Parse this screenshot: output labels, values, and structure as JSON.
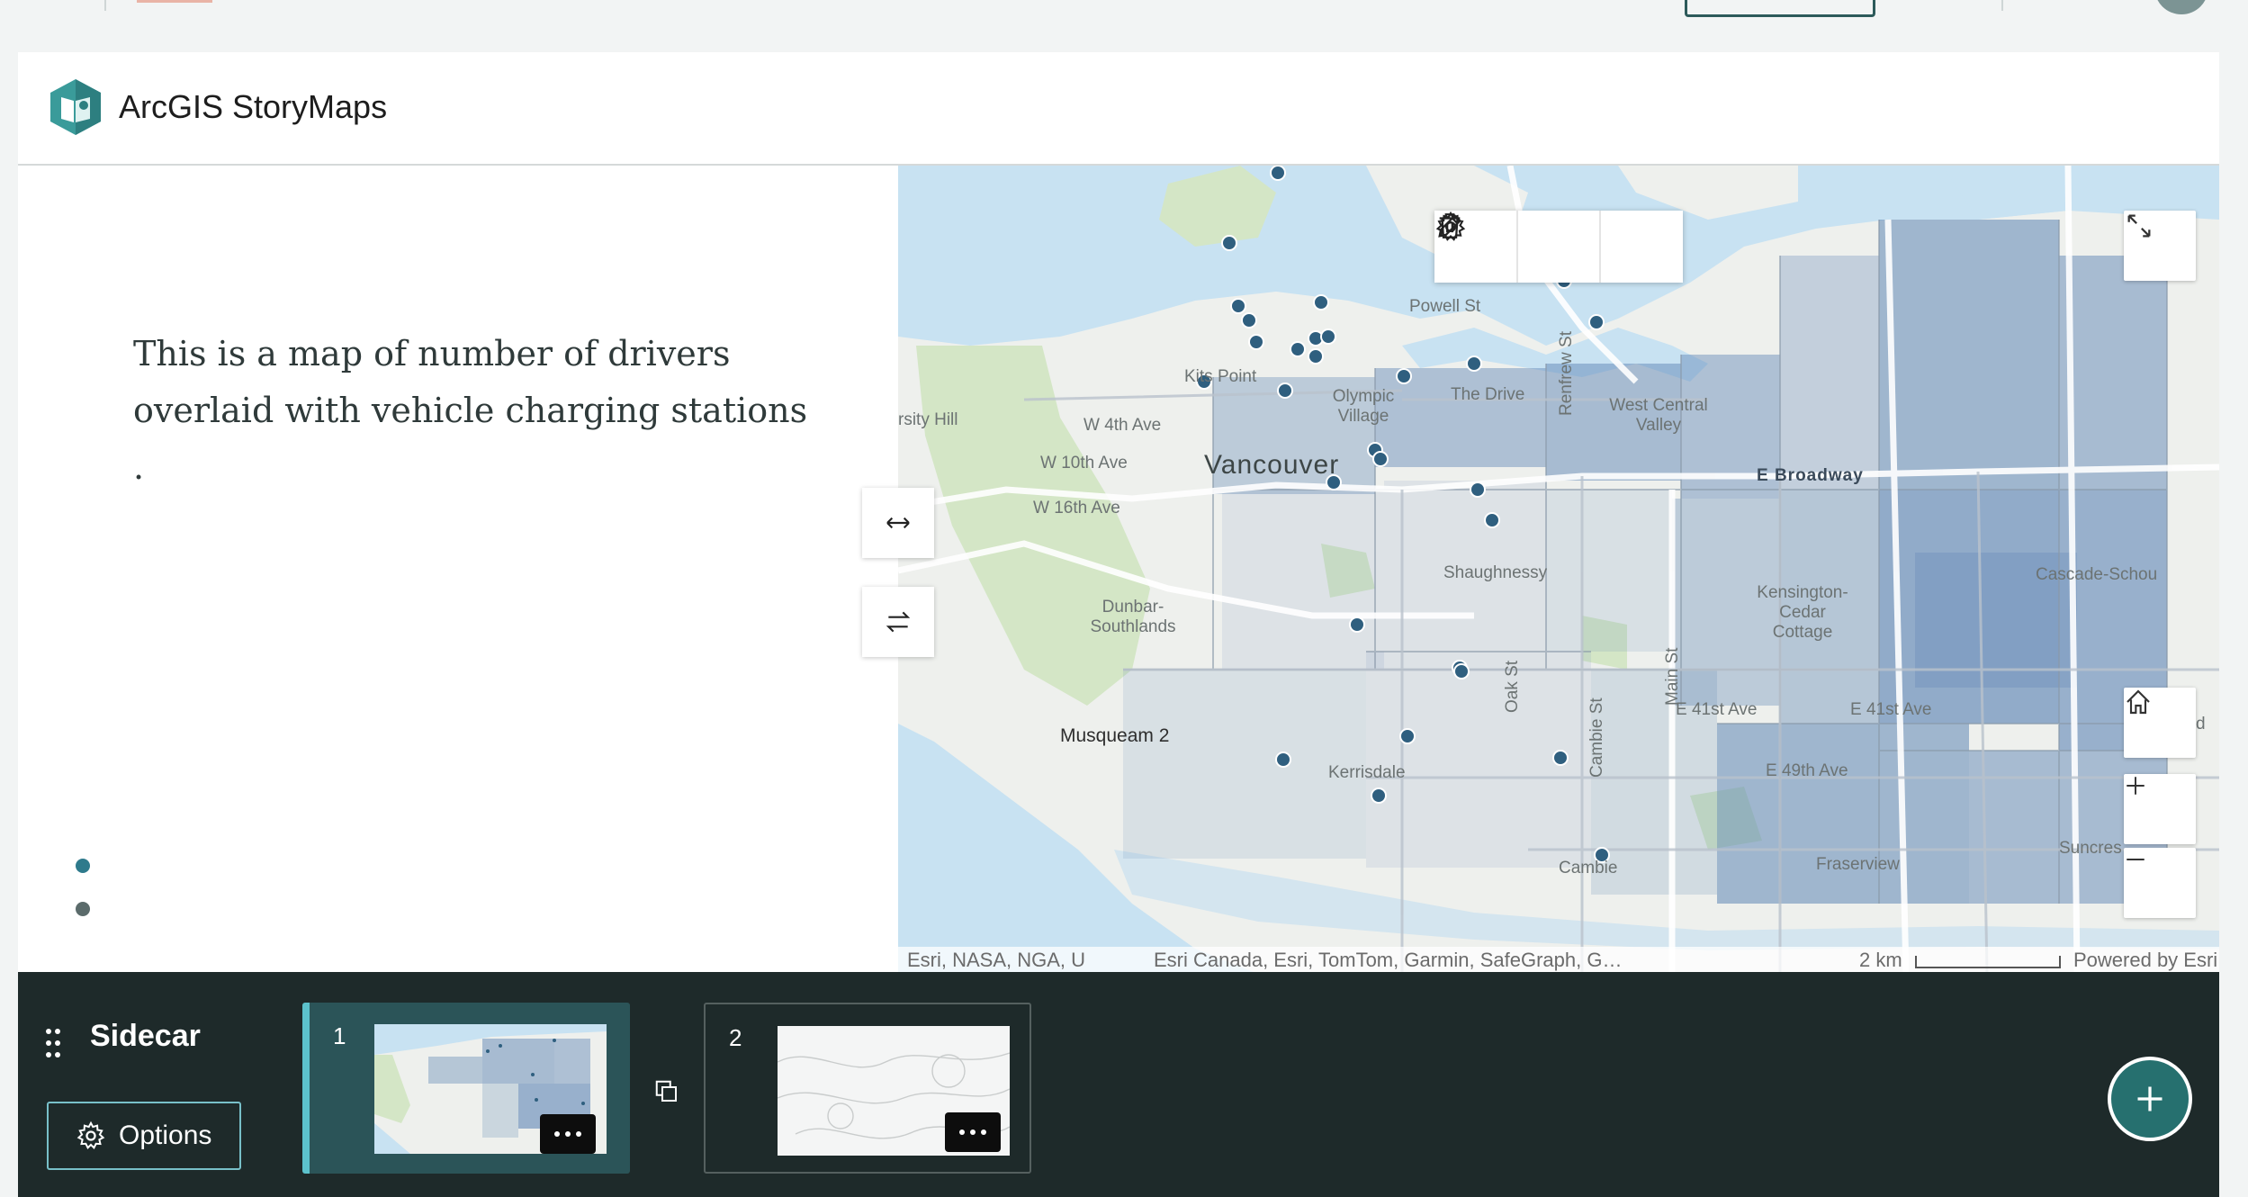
{
  "app": {
    "title": "ArcGIS StoryMaps"
  },
  "narrative": {
    "text": "This is a map of number of drivers overlaid with vehicle charging stations .",
    "progress_dots": 2,
    "active_dot": 1
  },
  "map": {
    "labels": {
      "vancouver": "Vancouver",
      "kits_point": "Kits Point",
      "olympic_village": "Olympic Village",
      "powell_st": "Powell St",
      "the_drive": "The Drive",
      "renfrew_st": "Renfrew St",
      "west_central_valley": "West Central Valley",
      "w4th": "W 4th Ave",
      "w10th": "W 10th Ave",
      "w16th": "W 16th Ave",
      "e_broadway": "E Broadway",
      "varsity_hill": "rsity Hill",
      "shaughnessy": "Shaughnessy",
      "dunbar": "Dunbar-Southlands",
      "kensington": "Kensington-Cedar Cottage",
      "cascade": "Cascade-Schou",
      "musqueam": "Musqueam 2",
      "kerrisdale": "Kerrisdale",
      "oak_st": "Oak St",
      "cambie_st": "Cambie St",
      "main_st": "Main St",
      "e41_a": "E 41st Ave",
      "e41_b": "E 41st Ave",
      "e49": "E 49th Ave",
      "cambie": "Cambie",
      "fraserview": "Fraserview",
      "suncrest": "Suncres",
      "edge_d": "d"
    },
    "attribution_left": "Esri, NASA, NGA, U",
    "attribution_right": "Esri Canada, Esri, TomTom, Garmin, SafeGraph, G…",
    "scale_label": "2 km",
    "powered_by": "Powered by Esri",
    "colors": {
      "water": "#c8e2f2",
      "land": "#eef0ed",
      "park": "#d4e6c6",
      "choropleth": "#5f86b5",
      "point": "#2f5f7f"
    }
  },
  "toolbar": {
    "edit": "pencil-icon",
    "settings": "gear-icon",
    "delete": "trash-icon"
  },
  "tray": {
    "title": "Sidecar",
    "options_label": "Options",
    "slides": [
      {
        "number": "1",
        "active": true
      },
      {
        "number": "2",
        "active": false
      }
    ]
  },
  "icons": {
    "expand": "expand-icon",
    "home": "home-icon",
    "zoom_in": "plus-icon",
    "zoom_out": "minus-icon",
    "resize": "horizontal-resize-icon",
    "swap": "swap-icon",
    "collapse": "chevron-down-icon",
    "grip": "drag-grip-icon",
    "add": "plus-icon",
    "duplicate": "duplicate-icon"
  }
}
